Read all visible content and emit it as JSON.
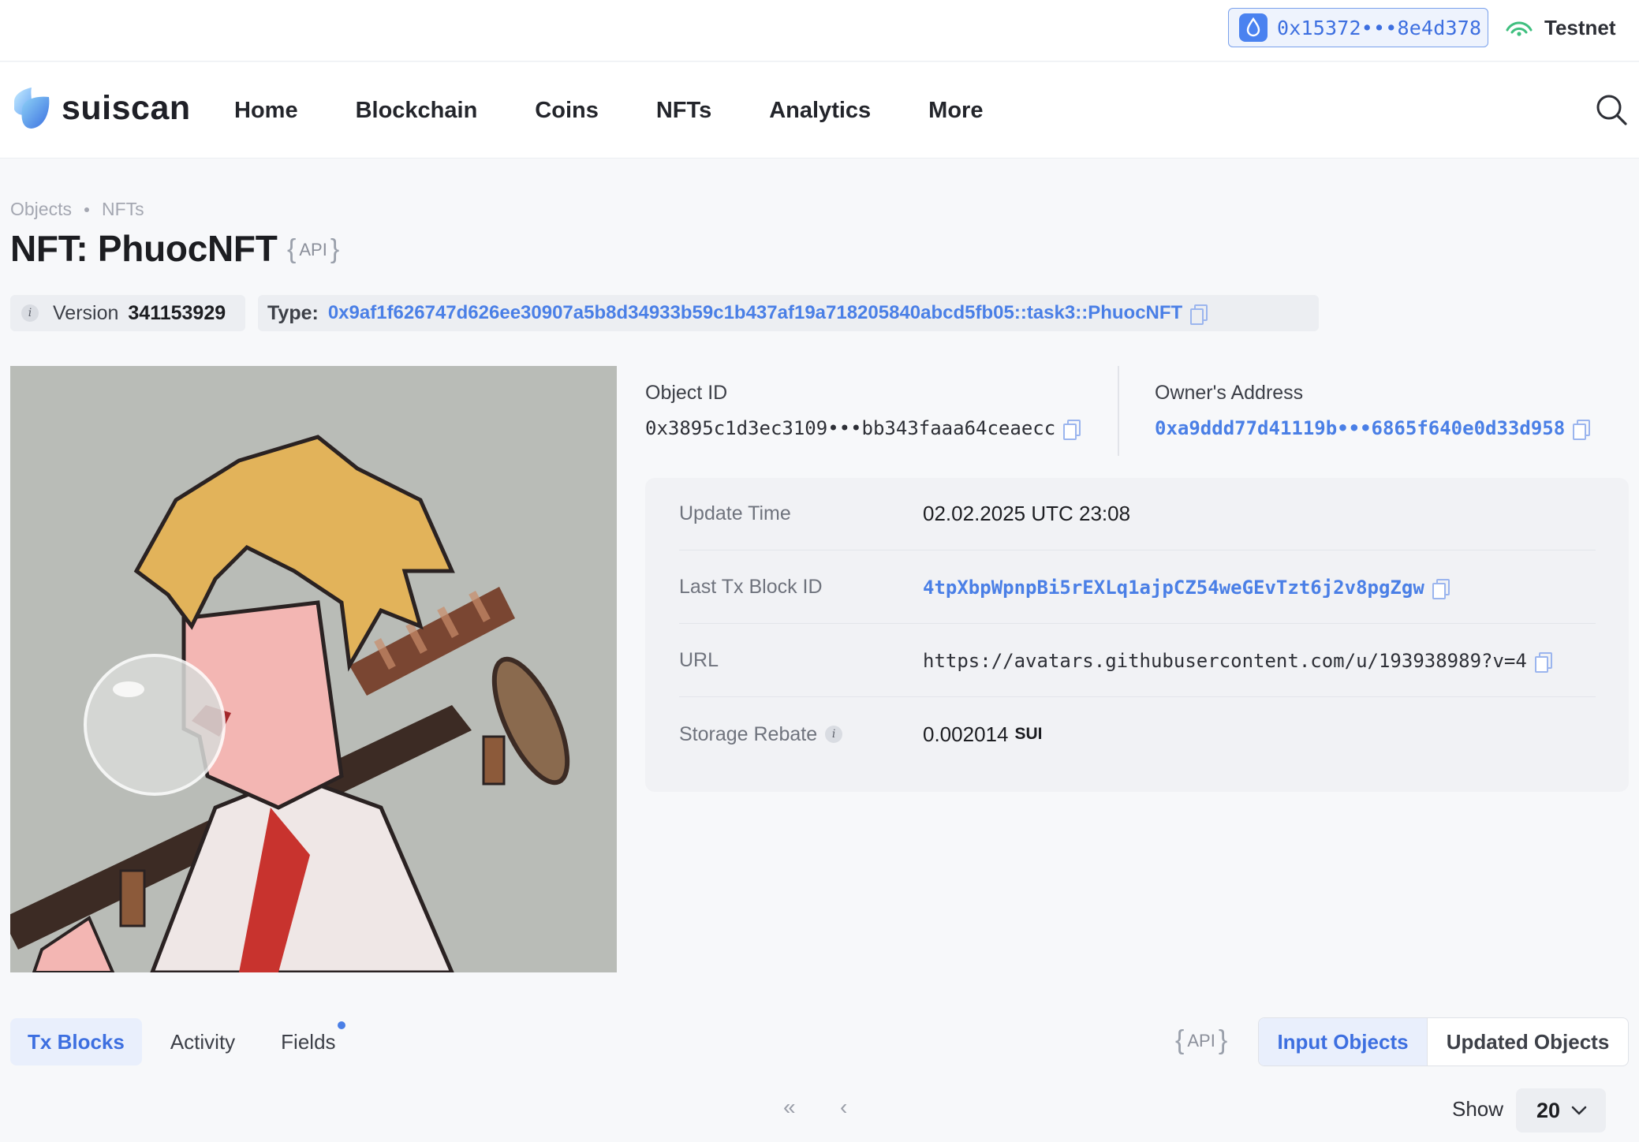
{
  "wallet": {
    "address": "0x15372•••8e4d378"
  },
  "network": {
    "label": "Testnet"
  },
  "brand": {
    "name": "suiscan"
  },
  "nav": {
    "items": [
      "Home",
      "Blockchain",
      "Coins",
      "NFTs",
      "Analytics",
      "More"
    ]
  },
  "breadcrumb": {
    "items": [
      "Objects",
      "NFTs"
    ]
  },
  "page": {
    "title": "NFT: PhuocNFT",
    "api_label": "API"
  },
  "meta": {
    "version_label": "Version",
    "version_value": "341153929",
    "type_label": "Type:",
    "type_value": "0x9af1f626747d626ee30907a5b8d34933b59c1b437af19a718205840abcd5fb05::task3::PhuocNFT"
  },
  "object": {
    "object_id_label": "Object ID",
    "object_id": "0x3895c1d3ec3109•••bb343faaa64ceaecc",
    "owner_label": "Owner's Address",
    "owner": "0xa9ddd77d41119b•••6865f640e0d33d958"
  },
  "details": {
    "update_time_label": "Update Time",
    "update_time": "02.02.2025 UTC 23:08",
    "last_tx_label": "Last Tx Block ID",
    "last_tx": "4tpXbpWpnpBi5rEXLq1ajpCZ54weGEvTzt6j2v8pgZgw",
    "url_label": "URL",
    "url": "https://avatars.githubusercontent.com/u/193938989?v=4",
    "storage_label": "Storage Rebate",
    "storage_value": "0.002014",
    "storage_unit": "SUI"
  },
  "tabs": {
    "items": [
      "Tx Blocks",
      "Activity",
      "Fields"
    ],
    "active": "Tx Blocks"
  },
  "api2": {
    "label": "API"
  },
  "objects_toggle": {
    "input": "Input Objects",
    "updated": "Updated Objects",
    "active": "Input Objects"
  },
  "pagination": {
    "first": "«",
    "prev": "‹",
    "show_label": "Show",
    "page_size": "20"
  },
  "colors": {
    "accent": "#4a7fe6",
    "network_green": "#3fbf7f",
    "background": "#f7f8fa"
  }
}
